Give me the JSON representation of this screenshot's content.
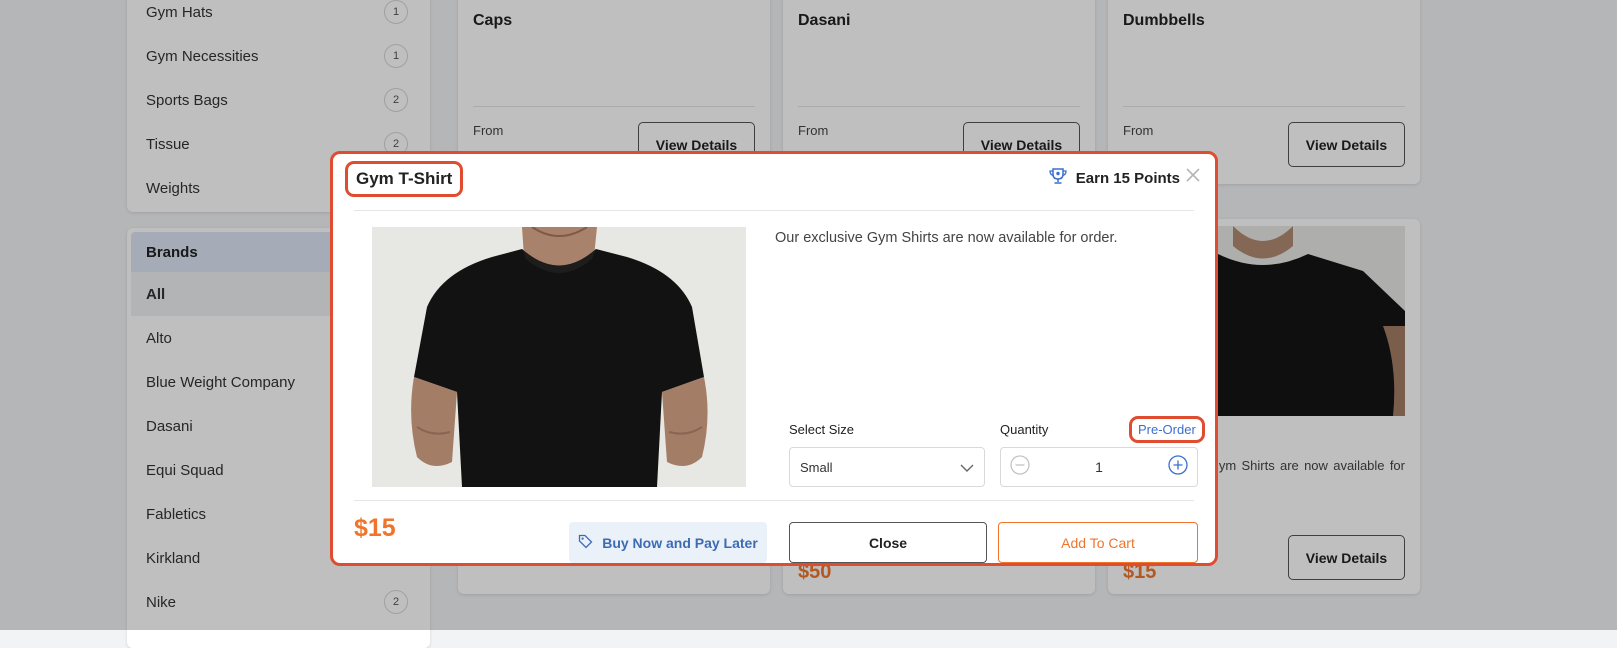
{
  "categories": {
    "items": [
      {
        "label": "Gym Hats",
        "count": "1"
      },
      {
        "label": "Gym Necessities",
        "count": "1"
      },
      {
        "label": "Sports Bags",
        "count": "2"
      },
      {
        "label": "Tissue",
        "count": "2"
      },
      {
        "label": "Weights",
        "count": ""
      }
    ]
  },
  "brands": {
    "header": "Brands",
    "items": [
      {
        "label": "All",
        "count": ""
      },
      {
        "label": "Alto",
        "count": ""
      },
      {
        "label": "Blue Weight Company",
        "count": ""
      },
      {
        "label": "Dasani",
        "count": ""
      },
      {
        "label": "Equi Squad",
        "count": ""
      },
      {
        "label": "Fabletics",
        "count": ""
      },
      {
        "label": "Kirkland",
        "count": ""
      },
      {
        "label": "Nike",
        "count": "2"
      }
    ]
  },
  "products_top": [
    {
      "name": "Caps",
      "from": "From",
      "button": "View Details"
    },
    {
      "name": "Dasani",
      "from": "From",
      "button": "View Details"
    },
    {
      "name": "Dumbbells",
      "from": "From",
      "button": "View Details"
    }
  ],
  "products_bottom": [
    {
      "price": ""
    },
    {
      "price": "$50"
    },
    {
      "price": "$15",
      "desc": "Our exclusive Gym Shirts are now available for order.",
      "button": "View Details"
    }
  ],
  "modal": {
    "title": "Gym T-Shirt",
    "points": "Earn 15 Points",
    "description": "Our exclusive Gym Shirts are now available for order.",
    "size_label": "Select Size",
    "size_value": "Small",
    "quantity_label": "Quantity",
    "quantity_value": "1",
    "preorder": "Pre-Order",
    "price": "$15",
    "bnpl": "Buy Now and Pay Later",
    "close": "Close",
    "add_to_cart": "Add To Cart"
  },
  "colors": {
    "accent": "#f0752b",
    "highlight": "#e04c2f",
    "link": "#3a6fd0"
  }
}
